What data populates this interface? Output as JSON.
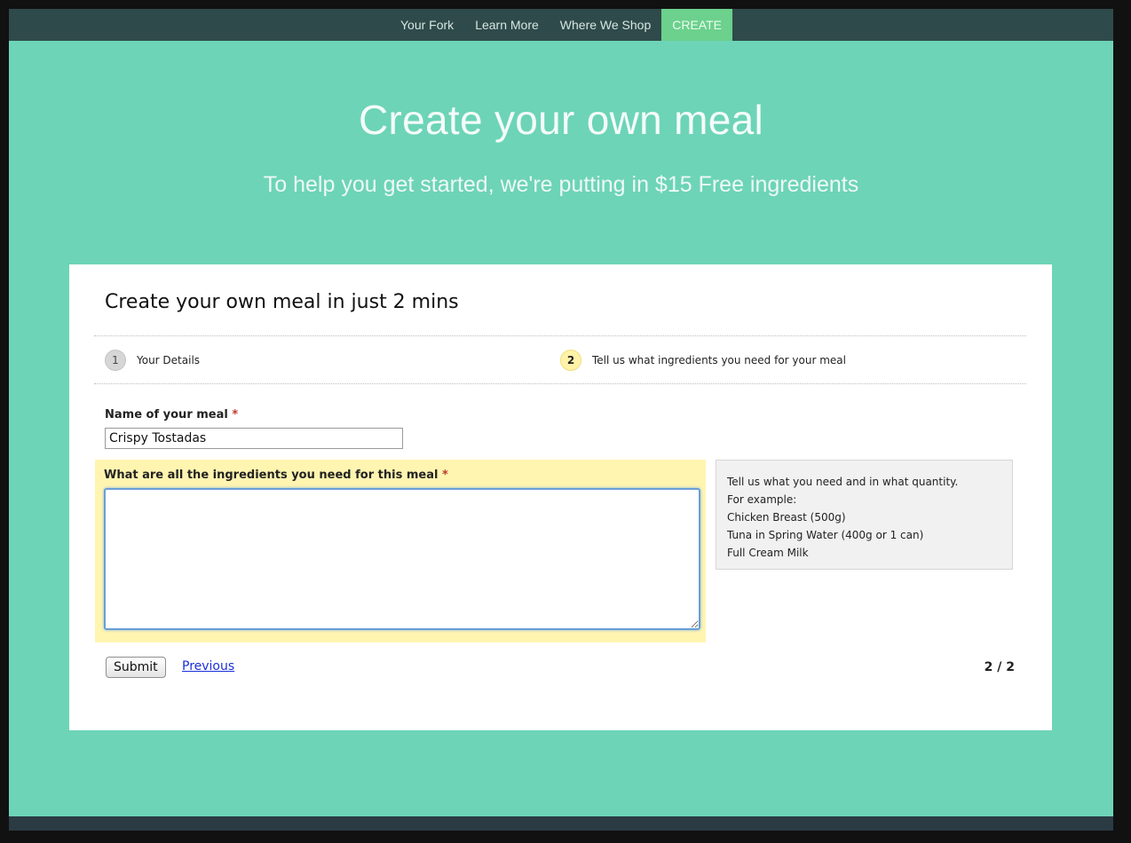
{
  "nav": {
    "items": [
      {
        "label": "Your Fork"
      },
      {
        "label": "Learn More"
      },
      {
        "label": "Where We Shop"
      },
      {
        "label": "CREATE"
      }
    ]
  },
  "hero": {
    "title": "Create your own meal",
    "subtitle": "To help you get started, we're putting in $15 Free ingredients"
  },
  "form": {
    "title": "Create your own meal in just 2 mins",
    "steps": [
      {
        "number": "1",
        "label": "Your Details"
      },
      {
        "number": "2",
        "label": "Tell us what ingredients you need for your meal"
      }
    ],
    "meal_name_label": "Name of your meal",
    "meal_name_value": "Crispy Tostadas",
    "required_mark": "*",
    "ingredients_label": "What are all the ingredients you need for this meal",
    "ingredients_value": "",
    "help": {
      "lines": [
        "Tell us what you need and in what quantity.",
        "For example:",
        "Chicken Breast (500g)",
        "Tuna in Spring Water (400g or 1 can)",
        "Full Cream Milk"
      ]
    },
    "submit_label": "Submit",
    "previous_label": "Previous",
    "page_indicator": "2 / 2"
  },
  "colors": {
    "background": "#6dd4b7",
    "navbar": "#2f4a4a",
    "nav_active": "#6bd18c",
    "highlight": "#fff5b0",
    "link": "#1a2fd8",
    "required": "#c0392b"
  }
}
